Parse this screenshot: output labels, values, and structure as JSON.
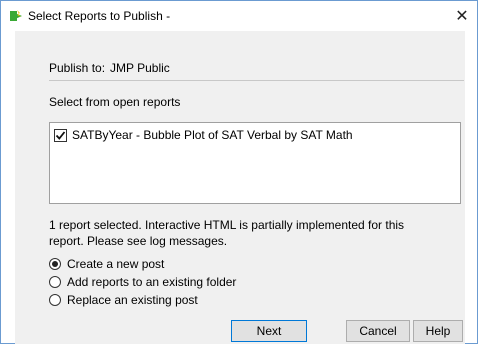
{
  "window": {
    "title": "Select Reports to Publish -",
    "close_glyph": "✕",
    "icon": "jmp-publish-icon"
  },
  "publish": {
    "label": "Publish to:",
    "value": "JMP Public"
  },
  "reports_section": {
    "label": "Select from open reports",
    "items": [
      {
        "label": "SATByYear - Bubble Plot of SAT Verbal by SAT Math",
        "checked": true
      }
    ]
  },
  "status": {
    "line1": "1 report selected. Interactive HTML is partially implemented for this",
    "line2": "report. Please see log messages."
  },
  "options": [
    {
      "label": "Create a new post",
      "selected": true
    },
    {
      "label": "Add reports to an existing folder",
      "selected": false
    },
    {
      "label": "Replace an existing post",
      "selected": false
    }
  ],
  "buttons": {
    "next": "Next",
    "cancel": "Cancel",
    "help": "Help"
  },
  "colors": {
    "icon_green": "#3aa935",
    "icon_yellow": "#f5c400",
    "window_border": "#6b9bd1",
    "focus_blue": "#0078d7"
  }
}
